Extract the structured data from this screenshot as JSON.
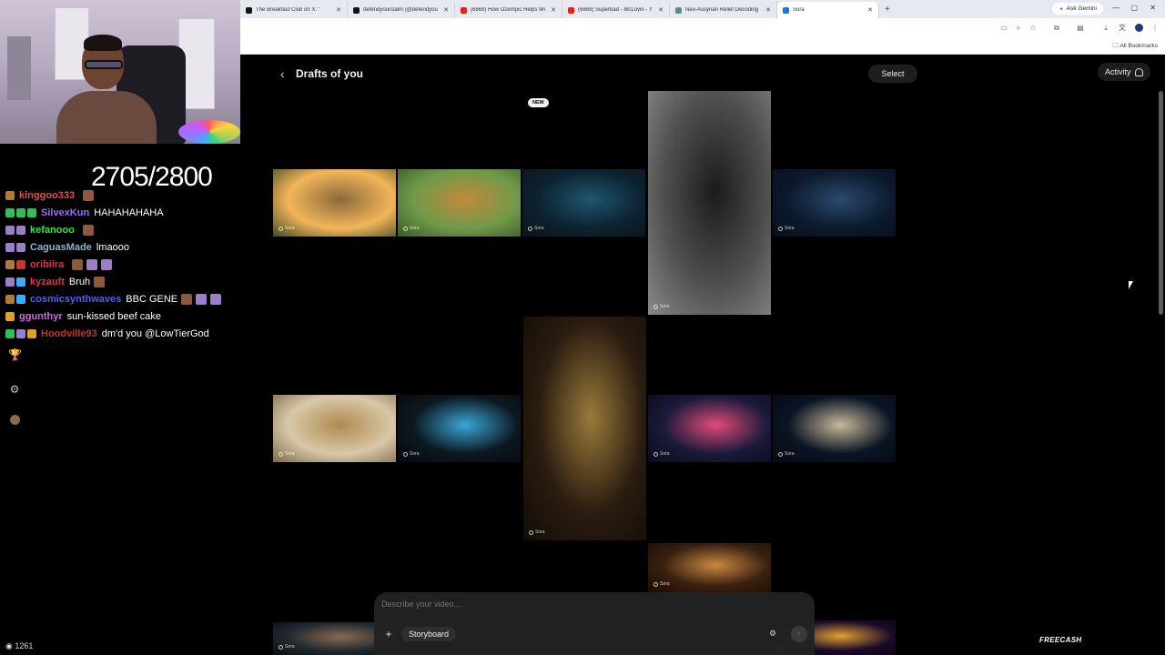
{
  "stream": {
    "goal_counter": "2705/2800",
    "viewer_count": "1261",
    "chat": [
      {
        "user": "kinggoo333",
        "color": "#d9534f",
        "message": "",
        "badges": [
          "#b07a3a"
        ],
        "emotes": 1
      },
      {
        "user": "SilvexKun",
        "color": "#9b6cf0",
        "message": "HAHAHAHAHA",
        "badges": [
          "#2fbf5a",
          "#2fbf5a",
          "#2fbf5a"
        ],
        "emotes": 0
      },
      {
        "user": "kefanooo",
        "color": "#37e24a",
        "message": "",
        "badges": [
          "#9a7fc6",
          "#9a7fc6"
        ],
        "emotes": 1
      },
      {
        "user": "CaguasMade",
        "color": "#8fb3c9",
        "message": "lmaooo",
        "badges": [
          "#9a7fc6",
          "#9a7fc6"
        ],
        "emotes": 0
      },
      {
        "user": "oribiira",
        "color": "#e0334c",
        "message": "",
        "badges": [
          "#b07a3a",
          "#c0392b"
        ],
        "emotes": 3
      },
      {
        "user": "kyzauft",
        "color": "#e0334c",
        "message": "Bruh",
        "badges": [
          "#9a7fc6",
          "#3fa8ff"
        ],
        "emotes": 1
      },
      {
        "user": "cosmicsynthwaves",
        "color": "#5b5bf0",
        "message": "BBC GENE",
        "badges": [
          "#b07a3a",
          "#3fa8ff"
        ],
        "emotes": 3
      },
      {
        "user": "ggunthyr",
        "color": "#cf67e3",
        "message": "sun-kissed beef cake",
        "badges": [
          "#e0a030"
        ],
        "emotes": 0
      },
      {
        "user": "Hoodville93",
        "color": "#c0392b",
        "message": "dm'd you @LowTierGod",
        "badges": [
          "#2fbf5a",
          "#9a7fc6",
          "#e0a030"
        ],
        "emotes": 0
      }
    ]
  },
  "browser": {
    "tabs": [
      {
        "title": "The Breakfast Club on X: \"",
        "favicon_color": "#111111",
        "active": false
      },
      {
        "title": "defendyourclaim (@defendyou",
        "favicon_color": "#111111",
        "active": false
      },
      {
        "title": "(6869) How Ozempic Helps Wi",
        "favicon_color": "#e62117",
        "active": false
      },
      {
        "title": "(6869) Superbad - McLovin - Y",
        "favicon_color": "#e62117",
        "active": false
      },
      {
        "title": "Neo-Assyrian Relief Decoding",
        "favicon_color": "#5a8f7b",
        "active": false
      },
      {
        "title": "Sora",
        "favicon_color": "#1a73e8",
        "active": true
      }
    ],
    "ask_gemini": "Ask Gemini",
    "all_bookmarks": "All Bookmarks"
  },
  "page": {
    "title": "Drafts of you",
    "select_label": "Select",
    "activity_label": "Activity",
    "new_badge": "NEW",
    "watermark": "Sora",
    "composer_placeholder": "Describe your video...",
    "storyboard_label": "Storyboard",
    "sponsor": "FREECASH",
    "thumbnails": [
      {
        "name": "draft-farmhouse-field",
        "colors": [
          "#f2b55a",
          "#8a6a3a",
          "#3e4a22"
        ]
      },
      {
        "name": "draft-rasta-beanie-portrait",
        "colors": [
          "#6f9a4a",
          "#c2893b",
          "#3a5a28"
        ]
      },
      {
        "name": "draft-neon-lab-figures",
        "colors": [
          "#0d2230",
          "#1f5670",
          "#0a1418"
        ]
      },
      {
        "name": "draft-supplement-bottle",
        "colors": [
          "#505050",
          "#1b1b1b",
          "#8a8a8a"
        ]
      },
      {
        "name": "draft-city-night-window",
        "colors": [
          "#0c1a2e",
          "#2a4a6e",
          "#07101d"
        ]
      },
      {
        "name": "draft-chandelier-gold-cloak",
        "colors": [
          "#2a1c10",
          "#9a7a3a",
          "#120c06"
        ]
      },
      {
        "name": "draft-desert-sunlit-portrait",
        "colors": [
          "#d8c8a8",
          "#b08a50",
          "#7a6a4a"
        ]
      },
      {
        "name": "draft-glowing-device",
        "colors": [
          "#0c1820",
          "#3aa6d6",
          "#05080c"
        ]
      },
      {
        "name": "draft-neon-city-suit",
        "colors": [
          "#1a1a3a",
          "#e04a7a",
          "#0a0a1a"
        ]
      },
      {
        "name": "draft-rooftop-white-suit",
        "colors": [
          "#0a1424",
          "#c8b89a",
          "#050a12"
        ]
      },
      {
        "name": "draft-warm-bokeh",
        "colors": [
          "#3a2010",
          "#c88a40",
          "#1a0c04"
        ]
      },
      {
        "name": "draft-bottom-left-portrait",
        "colors": [
          "#222a30",
          "#8a6a50",
          "#0a0c10"
        ]
      },
      {
        "name": "draft-bottom-right-stage",
        "colors": [
          "#1a0a2a",
          "#e0a030",
          "#0a0510"
        ]
      }
    ]
  }
}
